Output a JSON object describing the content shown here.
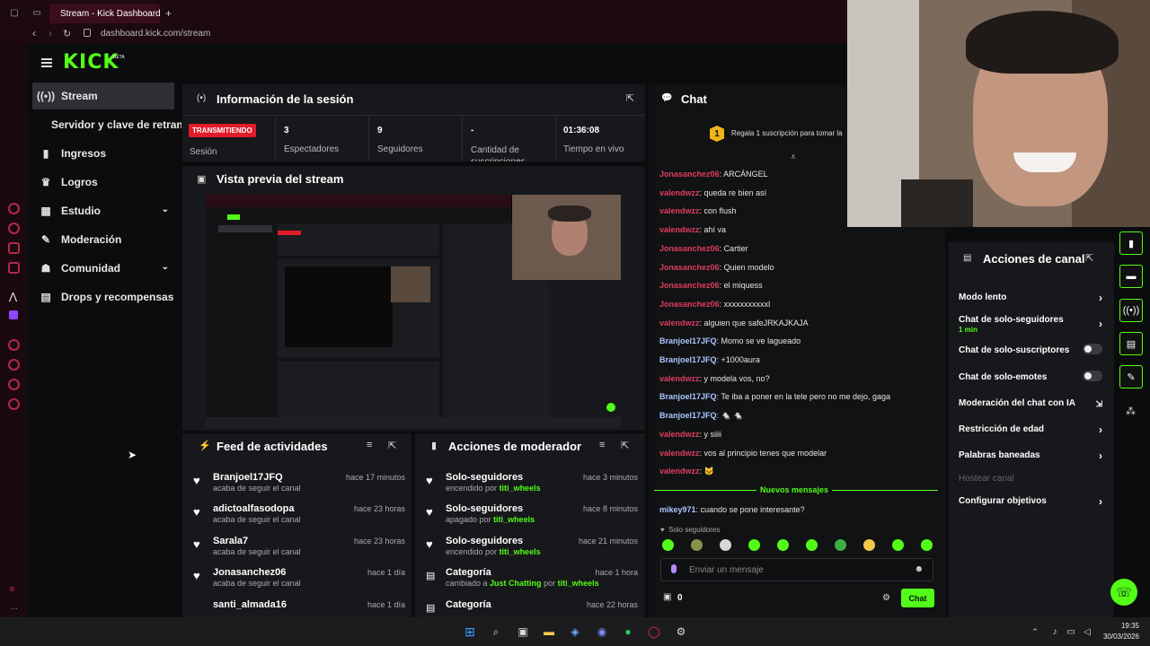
{
  "browser": {
    "tab_title": "Stream - Kick Dashboard",
    "new_tab": "+",
    "url": "dashboard.kick.com/stream"
  },
  "brand": {
    "logo": "KICK",
    "beta": "BETA",
    "accent": "#53fc18"
  },
  "sidebar": {
    "items": [
      {
        "label": "Stream",
        "icon": "broadcast-icon",
        "active": true
      },
      {
        "label": "Servidor y clave de retransm",
        "icon": ""
      },
      {
        "label": "Ingresos",
        "icon": "bar-chart-icon"
      },
      {
        "label": "Logros",
        "icon": "trophy-icon"
      },
      {
        "label": "Estudio",
        "icon": "studio-icon",
        "expand": true
      },
      {
        "label": "Moderación",
        "icon": "wrench-icon"
      },
      {
        "label": "Comunidad",
        "icon": "people-icon",
        "expand": true
      },
      {
        "label": "Drops y recompensas",
        "icon": "gift-icon"
      }
    ]
  },
  "session": {
    "title": "Información de la sesión",
    "live_badge": "TRANSMITIENDO",
    "session_label": "Sesión",
    "stats": [
      {
        "value": "3",
        "label": "Espectadores"
      },
      {
        "value": "9",
        "label": "Seguidores"
      },
      {
        "value": "-",
        "label": "Cantidad de suscripciones"
      },
      {
        "value": "01:36:08",
        "label": "Tiempo en vivo"
      }
    ]
  },
  "preview": {
    "title": "Vista previa del stream"
  },
  "activity": {
    "title": "Feed de actividades",
    "items": [
      {
        "user": "Branjoel17JFQ",
        "desc": "acaba de seguir el canal",
        "time": "hace 17 minutos"
      },
      {
        "user": "adictoalfasodopa",
        "desc": "acaba de seguir el canal",
        "time": "hace 23 horas"
      },
      {
        "user": "Sarala7",
        "desc": "acaba de seguir el canal",
        "time": "hace 23 horas"
      },
      {
        "user": "Jonasanchez06",
        "desc": "acaba de seguir el canal",
        "time": "hace 1 día"
      },
      {
        "user": "santi_almada16",
        "desc": "",
        "time": "hace 1 día"
      }
    ]
  },
  "modactions": {
    "title": "Acciones de moderador",
    "items": [
      {
        "title": "Solo-seguidores",
        "pre": "encendido por",
        "by": "titi_wheels",
        "time": "hace 3 minutos",
        "icon": "heart"
      },
      {
        "title": "Solo-seguidores",
        "pre": "apagado por",
        "by": "titi_wheels",
        "time": "hace 8 minutos",
        "icon": "heart"
      },
      {
        "title": "Solo-seguidores",
        "pre": "encendido por",
        "by": "titi_wheels",
        "time": "hace 21 minutos",
        "icon": "heart"
      },
      {
        "title": "Categoría",
        "pre": "cambiado a",
        "cat": "Just Chatting",
        "mid": "por",
        "by": "titi_wheels",
        "time": "hace 1 hora",
        "icon": "category"
      },
      {
        "title": "Categoría",
        "pre": "",
        "by": "",
        "time": "hace 22 horas",
        "icon": "category"
      }
    ]
  },
  "chat": {
    "title": "Chat",
    "gift_count": "1",
    "gift_text": "Regala 1 suscripción para tomar la",
    "messages": [
      {
        "user": "Jonasanchez06",
        "color": "red",
        "text": "ARCÁNGEL"
      },
      {
        "user": "valendwzz",
        "color": "red",
        "text": "queda re bien así"
      },
      {
        "user": "valendwzz",
        "color": "red",
        "text": "con flush"
      },
      {
        "user": "valendwzz",
        "color": "red",
        "text": "ahí va"
      },
      {
        "user": "Jonasanchez06",
        "color": "red",
        "text": "Cartier"
      },
      {
        "user": "Jonasanchez06",
        "color": "red",
        "text": "Quien modelo"
      },
      {
        "user": "Jonasanchez06",
        "color": "red",
        "text": "el miquess"
      },
      {
        "user": "Jonasanchez06",
        "color": "red",
        "text": "xxxxxxxxxxxl"
      },
      {
        "user": "valendwzz",
        "color": "red",
        "text": "alguien que safeJRKAJKAJA"
      },
      {
        "user": "Branjoel17JFQ",
        "color": "blue",
        "text": "Momo se ve lagueado"
      },
      {
        "user": "Branjoel17JFQ",
        "color": "blue",
        "text": "+1000aura"
      },
      {
        "user": "valendwzz",
        "color": "red",
        "text": "y modela vos, no?"
      },
      {
        "user": "Branjoel17JFQ",
        "color": "blue",
        "text": "Te iba a poner en la tele pero no me dejo, gaga"
      },
      {
        "user": "Branjoel17JFQ",
        "color": "blue",
        "text": "🐁 🐁"
      },
      {
        "user": "valendwzz",
        "color": "red",
        "text": "y siiii"
      },
      {
        "user": "valendwzz",
        "color": "red",
        "text": "vos al principio tenes que modelar"
      },
      {
        "user": "valendwzz",
        "color": "red",
        "text": "🐱"
      }
    ],
    "new_messages": "Nuevos mensajes",
    "last_message": {
      "user": "mikey971",
      "text": "cuando se pone interesante?"
    },
    "followers_only": "Solo seguidores",
    "input_placeholder": "Enviar un mensaje",
    "points": "0",
    "send_label": "Chat"
  },
  "channel_actions": {
    "title": "Acciones de canal",
    "items": [
      {
        "label": "Modo lento",
        "control": "chevron"
      },
      {
        "label": "Chat de solo-seguidores",
        "sub": "1 min",
        "control": "chevron"
      },
      {
        "label": "Chat de solo-suscriptores",
        "control": "toggle"
      },
      {
        "label": "Chat de solo-emotes",
        "control": "toggle"
      },
      {
        "label": "Moderación del chat con IA",
        "control": "external"
      },
      {
        "label": "Restricción de edad",
        "control": "chevron"
      },
      {
        "label": "Palabras baneadas",
        "control": "chevron"
      },
      {
        "label": "Hostear canal",
        "control": "none",
        "disabled": true
      },
      {
        "label": "Configurar objetivos",
        "control": "chevron"
      }
    ]
  },
  "taskbar": {
    "time": "19:35",
    "date": "30/03/2026"
  }
}
